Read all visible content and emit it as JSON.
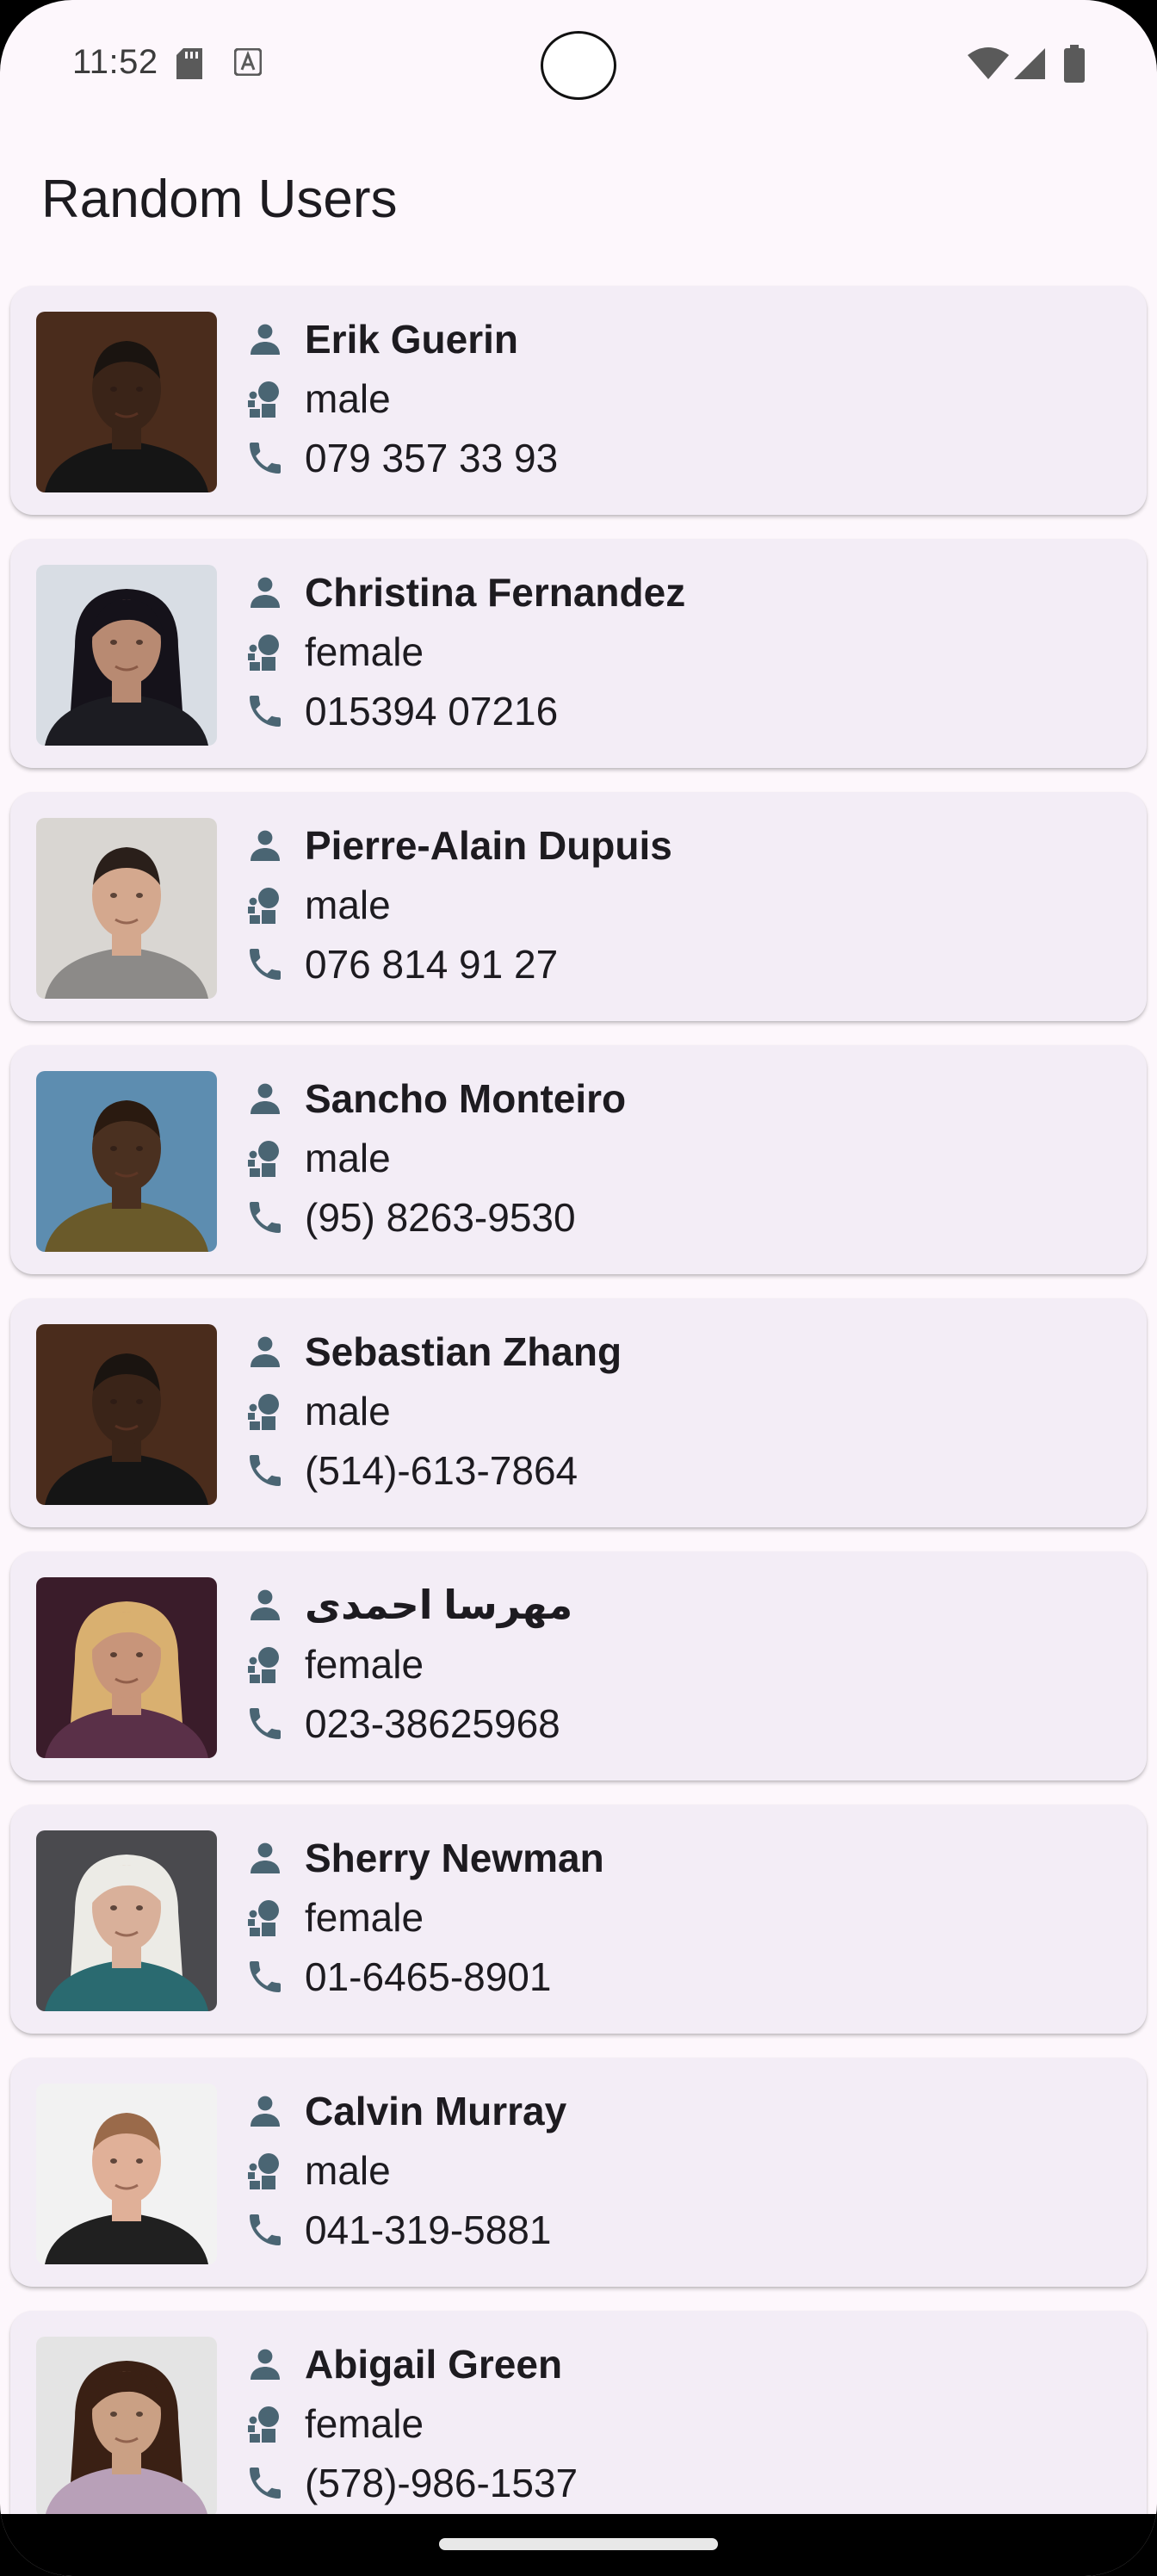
{
  "status_bar": {
    "time": "11:52",
    "icons": [
      "sd-card-icon",
      "a-notification-icon",
      "wifi-icon",
      "signal-icon",
      "battery-icon"
    ]
  },
  "app": {
    "title": "Random Users"
  },
  "colors": {
    "background": "#fdf7fc",
    "card": "#f3edf6",
    "icon": "#4a6573",
    "text": "#1d1b20"
  },
  "users": [
    {
      "name": "Erik Guerin",
      "gender": "male",
      "phone": "079 357 33 93",
      "avatar": {
        "skin": "#3a2418",
        "hair": "#1a1410",
        "shirt": "#151515",
        "bg": "#4a2c1c"
      }
    },
    {
      "name": "Christina Fernandez",
      "gender": "female",
      "phone": "015394 07216",
      "avatar": {
        "skin": "#b88a72",
        "hair": "#15121a",
        "shirt": "#1c1c22",
        "bg": "#d8dde4"
      }
    },
    {
      "name": "Pierre-Alain Dupuis",
      "gender": "male",
      "phone": "076 814 91 27",
      "avatar": {
        "skin": "#d4a88e",
        "hair": "#2a1f1a",
        "shirt": "#8c8a88",
        "bg": "#d9d6d2"
      }
    },
    {
      "name": "Sancho Monteiro",
      "gender": "male",
      "phone": "(95) 8263-9530",
      "avatar": {
        "skin": "#4a3020",
        "hair": "#2a1a10",
        "shirt": "#6a5a2a",
        "bg": "#5d8db0"
      }
    },
    {
      "name": "Sebastian Zhang",
      "gender": "male",
      "phone": "(514)-613-7864",
      "avatar": {
        "skin": "#3a2418",
        "hair": "#1a1410",
        "shirt": "#151515",
        "bg": "#4a2c1c"
      }
    },
    {
      "name": "مهرسا احمدی",
      "gender": "female",
      "phone": "023-38625968",
      "avatar": {
        "skin": "#c8957a",
        "hair": "#d9b070",
        "shirt": "#5a3048",
        "bg": "#3a1c2a"
      }
    },
    {
      "name": "Sherry Newman",
      "gender": "female",
      "phone": "01-6465-8901",
      "avatar": {
        "skin": "#d9b09a",
        "hair": "#ecebe6",
        "shirt": "#2a6a70",
        "bg": "#4a4a4e"
      }
    },
    {
      "name": "Calvin Murray",
      "gender": "male",
      "phone": "041-319-5881",
      "avatar": {
        "skin": "#e0b098",
        "hair": "#9a6a4a",
        "shirt": "#202020",
        "bg": "#f2f2f2"
      }
    },
    {
      "name": "Abigail Green",
      "gender": "female",
      "phone": "(578)-986-1537",
      "avatar": {
        "skin": "#caa084",
        "hair": "#3a2014",
        "shirt": "#b8a0b8",
        "bg": "#e4e4e4"
      }
    }
  ]
}
